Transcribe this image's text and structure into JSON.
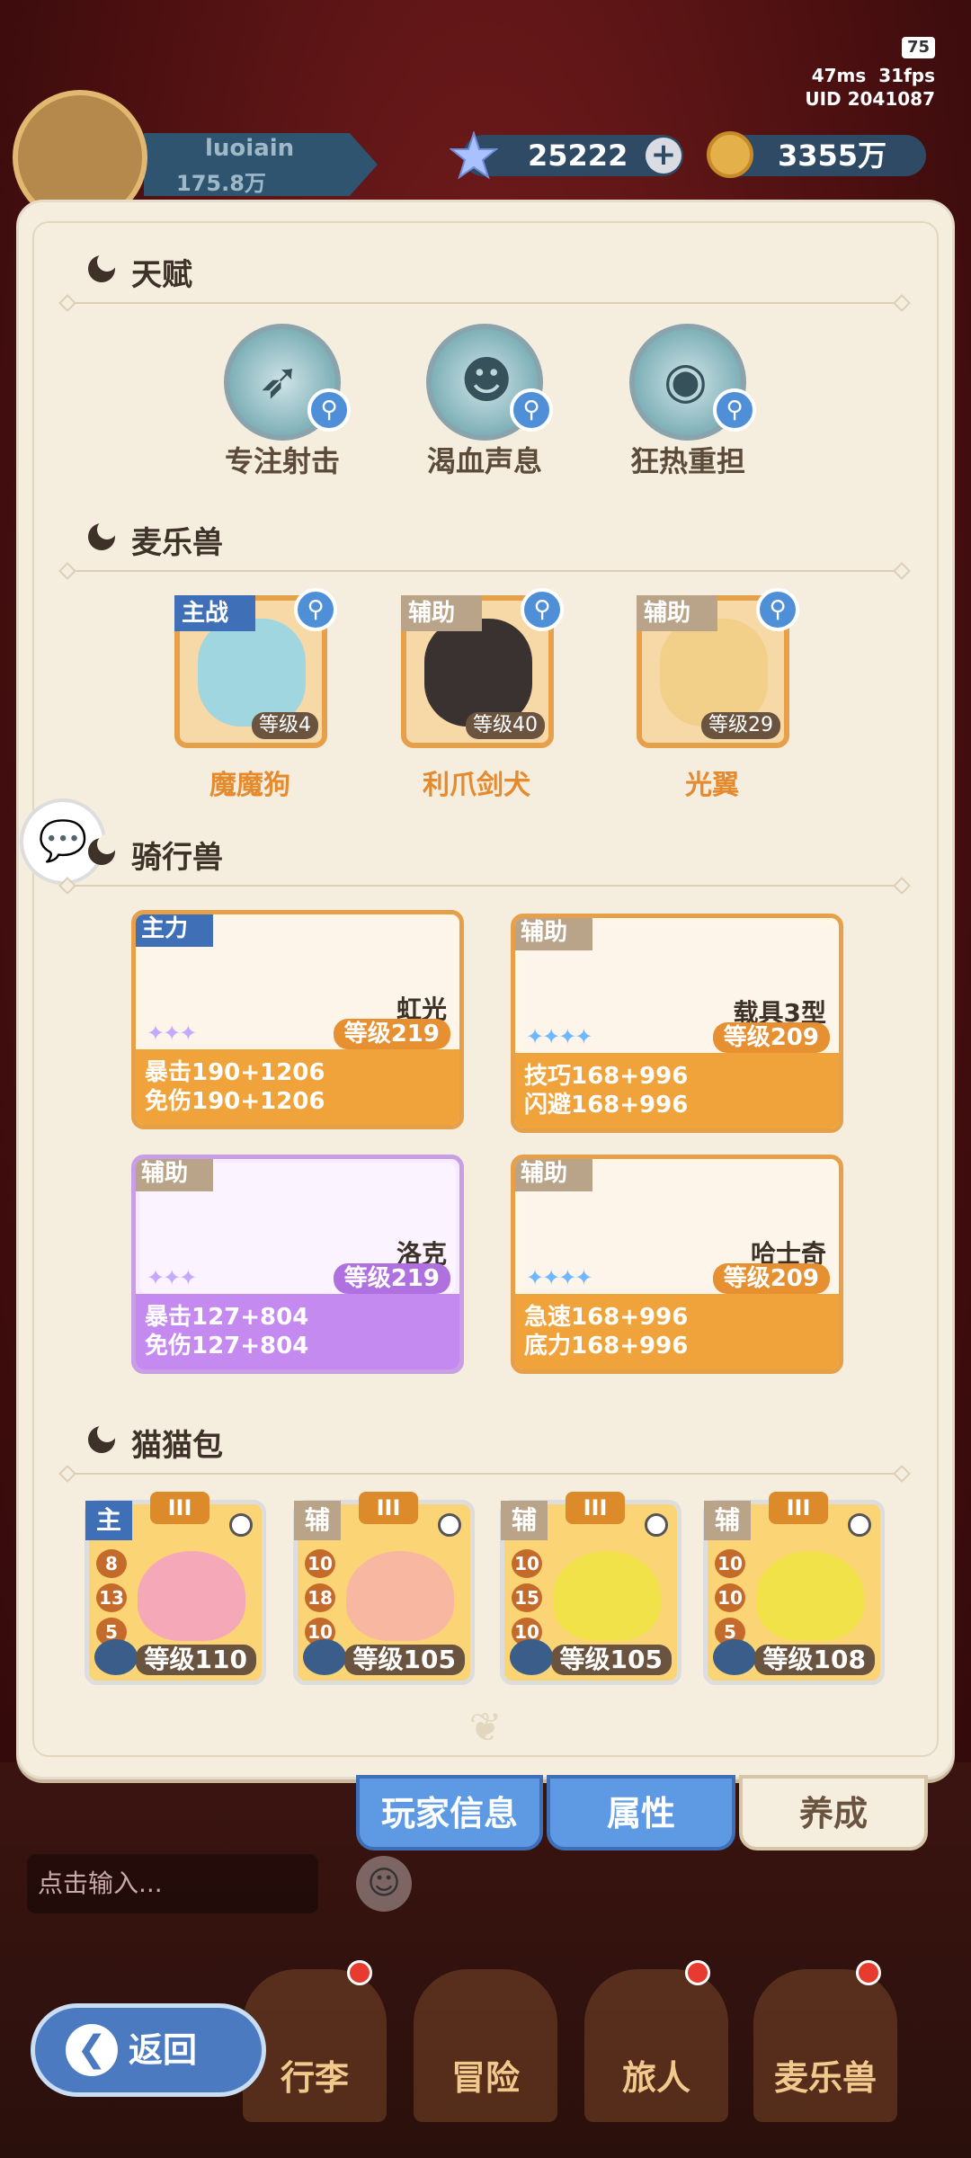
{
  "status": {
    "battery": "75",
    "ping": "47ms",
    "fps": "31fps",
    "uid": "UID 2041087"
  },
  "player": {
    "name": "luoiain",
    "power": "175.8万"
  },
  "resources": {
    "gems": "25222",
    "coins": "3355万",
    "plus": "+"
  },
  "sections": {
    "talent": "天赋",
    "pets": "麦乐兽",
    "mounts": "骑行兽",
    "cats": "猫猫包"
  },
  "talents": [
    {
      "label": "专注射击",
      "icon": "bow-icon"
    },
    {
      "label": "渴血声息",
      "icon": "drop-ghost-icon"
    },
    {
      "label": "狂热重担",
      "icon": "eye-shield-icon"
    }
  ],
  "pets": [
    {
      "tag": "主战",
      "level": "等级4",
      "name": "魔魔狗",
      "tag_color": "#3f6fb6"
    },
    {
      "tag": "辅助",
      "level": "等级40",
      "name": "利爪剑犬",
      "tag_color": "#b9a48a"
    },
    {
      "tag": "辅助",
      "level": "等级29",
      "name": "光翼",
      "tag_color": "#b9a48a"
    }
  ],
  "mounts": [
    {
      "tag": "主力",
      "name": "虹光",
      "level": "等级219",
      "stat1": "暴击190+1206",
      "stat2": "免伤190+1206"
    },
    {
      "tag": "辅助",
      "name": "载具3型",
      "level": "等级209",
      "stat1": "技巧168+996",
      "stat2": "闪避168+996"
    },
    {
      "tag": "辅助",
      "name": "洛克",
      "level": "等级219",
      "stat1": "暴击127+804",
      "stat2": "免伤127+804"
    },
    {
      "tag": "辅助",
      "name": "哈士奇",
      "level": "等级209",
      "stat1": "急速168+996",
      "stat2": "底力168+996"
    }
  ],
  "cats": [
    {
      "tag": "主",
      "tier": "III",
      "n1": "8",
      "n2": "13",
      "n3": "5",
      "level": "等级110"
    },
    {
      "tag": "辅",
      "tier": "III",
      "n1": "10",
      "n2": "18",
      "n3": "10",
      "level": "等级105"
    },
    {
      "tag": "辅",
      "tier": "III",
      "n1": "10",
      "n2": "15",
      "n3": "10",
      "level": "等级105"
    },
    {
      "tag": "辅",
      "tier": "III",
      "n1": "10",
      "n2": "10",
      "n3": "5",
      "level": "等级108"
    }
  ],
  "tabs": {
    "info": "玩家信息",
    "attr": "属性",
    "grow": "养成"
  },
  "chat": {
    "placeholder": "点击输入..."
  },
  "nav": {
    "bag": "行李",
    "adventure": "冒险",
    "traveler": "旅人",
    "pets": "麦乐兽",
    "back": "返回"
  }
}
